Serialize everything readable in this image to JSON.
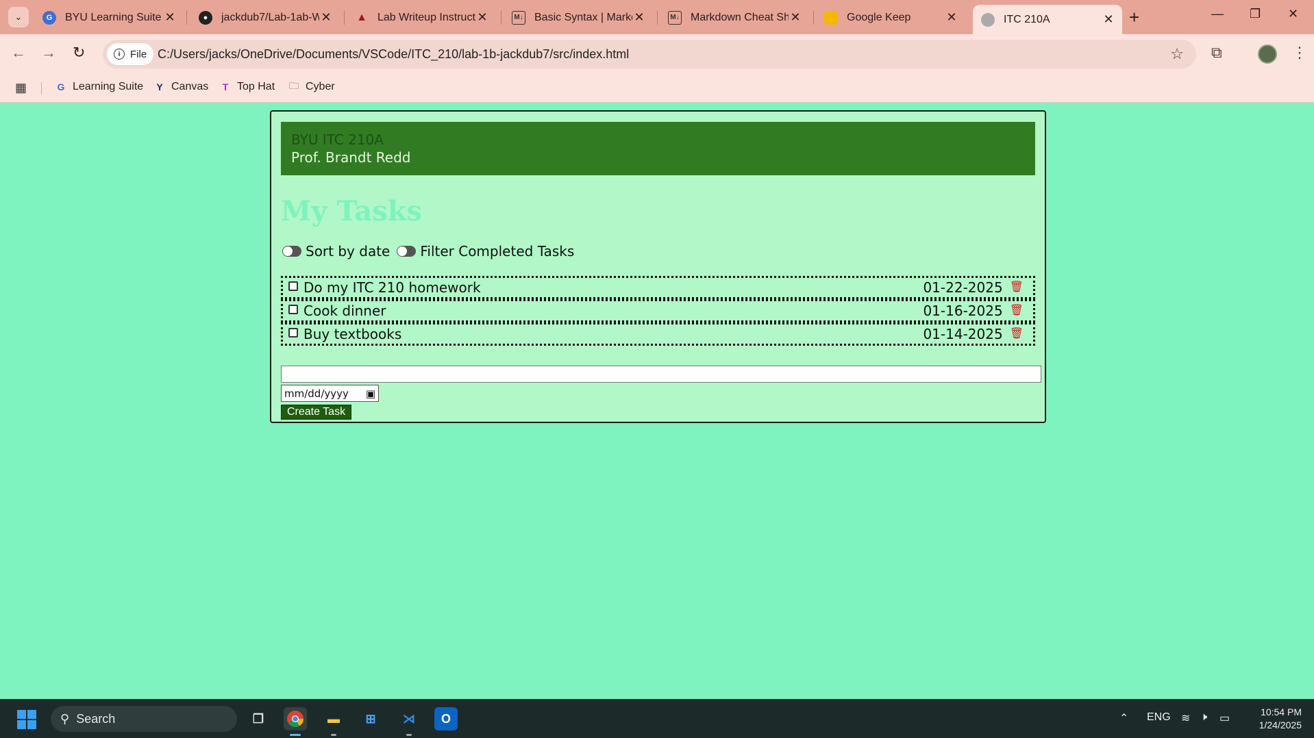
{
  "browser": {
    "tabs": [
      {
        "title": "BYU Learning Suite",
        "icon": "learning-suite-icon"
      },
      {
        "title": "jackdub7/Lab-1ab-W",
        "icon": "github-icon"
      },
      {
        "title": "Lab Writeup Instructi",
        "icon": "flask-icon"
      },
      {
        "title": "Basic Syntax | Markd",
        "icon": "markdown-icon"
      },
      {
        "title": "Markdown Cheat Sh",
        "icon": "markdown-icon"
      },
      {
        "title": "Google Keep",
        "icon": "keep-icon"
      },
      {
        "title": "ITC 210A",
        "icon": "globe-icon"
      }
    ],
    "new_tab_symbol": "+",
    "site_chip_label": "File",
    "url": "C:/Users/jacks/OneDrive/Documents/VSCode/ITC_210/lab-1b-jackdub7/src/index.html",
    "bookmarks": [
      {
        "label": "Learning Suite",
        "icon": "learning-suite-icon"
      },
      {
        "label": "Canvas",
        "icon": "canvas-icon"
      },
      {
        "label": "Top Hat",
        "icon": "top-hat-icon"
      },
      {
        "label": "Cyber",
        "icon": "folder-icon"
      }
    ]
  },
  "page": {
    "header": {
      "course": "BYU ITC 210A",
      "professor": "Prof. Brandt Redd"
    },
    "title": "My Tasks",
    "toggles": {
      "sort_label": "Sort by date",
      "filter_label": "Filter Completed Tasks"
    },
    "tasks": [
      {
        "name": "Do my ITC 210 homework",
        "date": "01-22-2025",
        "completed": false
      },
      {
        "name": "Cook dinner",
        "date": "01-16-2025",
        "completed": false
      },
      {
        "name": "Buy textbooks",
        "date": "01-14-2025",
        "completed": false
      }
    ],
    "new_task": {
      "text_value": "",
      "date_placeholder": "mm/dd/yyyy",
      "create_label": "Create Task"
    },
    "colors": {
      "background": "#7ef2bf",
      "card": "#b1f7c8",
      "header": "#317c23",
      "button": "#1f5c10",
      "delete": "#d61f1f"
    }
  },
  "taskbar": {
    "search_label": "Search",
    "language": "ENG",
    "time": "10:54 PM",
    "date": "1/24/2025"
  }
}
